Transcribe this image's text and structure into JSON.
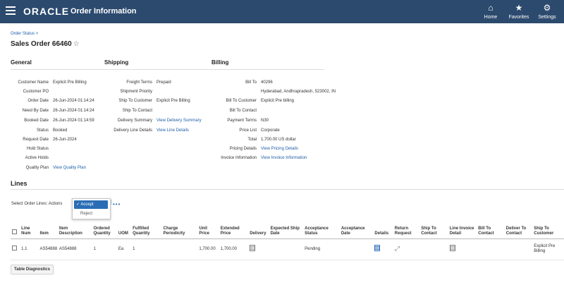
{
  "header": {
    "brand": "ORACLE",
    "app_title": "Order Information",
    "nav": [
      {
        "label": "Home",
        "icon": "home-icon"
      },
      {
        "label": "Favorites",
        "icon": "star-icon"
      },
      {
        "label": "Settings",
        "icon": "gear-icon"
      }
    ]
  },
  "breadcrumb": "Order Status  >",
  "page_title": "Sales Order 66460",
  "sections": {
    "general": "General",
    "shipping": "Shipping",
    "billing": "Billing"
  },
  "general": [
    {
      "label": "Customer Name",
      "value": "Explicit Pre Billing"
    },
    {
      "label": "Customer PO",
      "value": ""
    },
    {
      "label": "Order Date",
      "value": "26-Jun-2024 01:14:24"
    },
    {
      "label": "Need By Date",
      "value": "26-Jun-2024 01:14:24"
    },
    {
      "label": "Booked Date",
      "value": "26-Jun-2024 01:14:59"
    },
    {
      "label": "Status",
      "value": "Booked"
    },
    {
      "label": "Request Date",
      "value": "26-Jun-2024"
    },
    {
      "label": "Hold Status",
      "value": ""
    },
    {
      "label": "Active Holds",
      "value": ""
    },
    {
      "label": "Quality Plan",
      "value": "View Quality Plan"
    }
  ],
  "shipping": [
    {
      "label": "Freight Terms",
      "value": "Prepaid"
    },
    {
      "label": "Shipment Priority",
      "value": ""
    },
    {
      "label": "Ship To Customer",
      "value": "Explicit Pre Billing"
    },
    {
      "label": "Ship To Contact",
      "value": ""
    },
    {
      "label": "Delivery Summary",
      "value": "View Delivery Summary"
    },
    {
      "label": "Delivery Line Details",
      "value": "View Line Details"
    }
  ],
  "billing": [
    {
      "label": "Bill To",
      "value": "40296"
    },
    {
      "label": "",
      "value": "Hyderabad, Andhrapradesh, 523002, IN"
    },
    {
      "label": "Bill To Customer",
      "value": "Explicit Pre billing"
    },
    {
      "label": "Bill To Contact",
      "value": ""
    },
    {
      "label": "Payment Terms",
      "value": "N30"
    },
    {
      "label": "Price List",
      "value": "Corporate"
    },
    {
      "label": "Total",
      "value": "1,700.00 US dollar"
    },
    {
      "label": "Pricing Details",
      "value": "View Pricing Details"
    },
    {
      "label": "Invoice Information",
      "value": "View Invoice Information"
    }
  ],
  "lines": {
    "title": "Lines",
    "actions_label": "Select Order Lines: Actions",
    "menu_selected": "✓ Accept",
    "menu_option": "Reject",
    "more": "•••",
    "columns": [
      "Line Num",
      "Item",
      "Item Description",
      "Ordered Quantity",
      "UOM",
      "Fulfilled Quantity",
      "Charge Periodicity",
      "Unit Price",
      "Extended Price",
      "Delivery",
      "Expected Ship Date",
      "Acceptance Status",
      "Acceptance Date",
      "Details",
      "Return Request",
      "Ship To Contact",
      "Line Invoice Detail",
      "Bill To Contact",
      "Deliver To Contact",
      "Ship To Customer"
    ],
    "rows": [
      {
        "line_num": "1.1",
        "item": "AS54888",
        "item_description": "AS54888",
        "ordered_quantity": "1",
        "uom": "Ea",
        "fulfilled_quantity": "1",
        "charge_periodicity": "",
        "unit_price": "1,700.00",
        "extended_price": "1,700.00",
        "expected_ship_date": "",
        "acceptance_status": "Pending",
        "acceptance_date": "",
        "ship_to_contact": "",
        "bill_to_contact": "",
        "deliver_to_contact": "",
        "ship_to_customer": "Explicit Pre Billing"
      }
    ]
  },
  "table_diagnostics": "Table Diagnostics"
}
